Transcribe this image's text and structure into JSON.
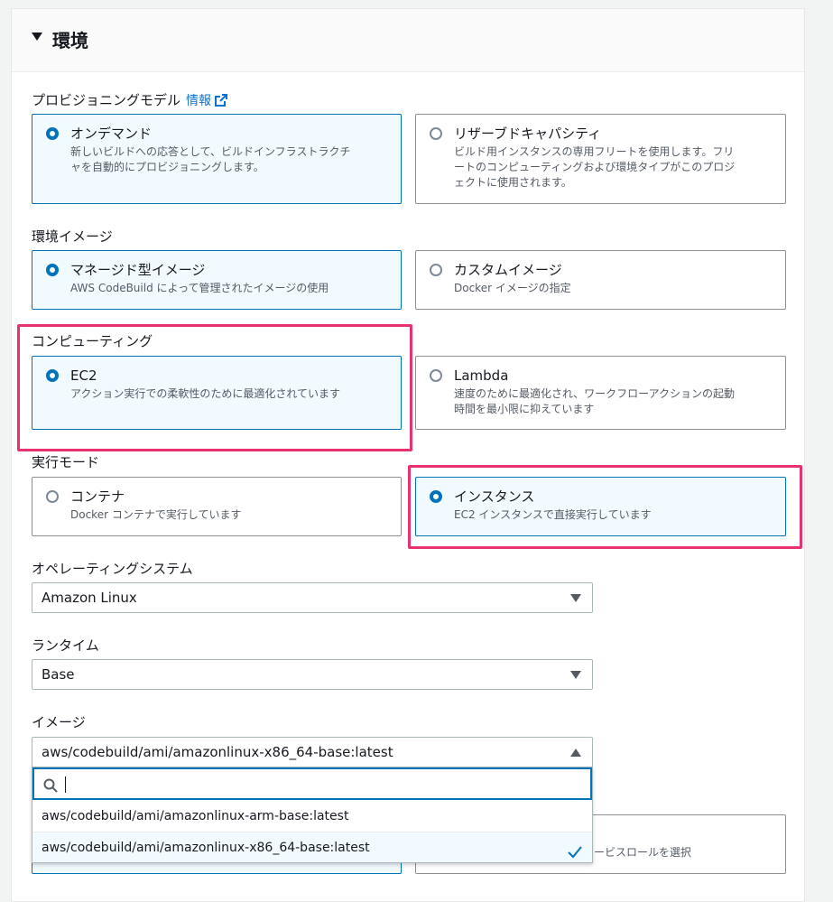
{
  "section": {
    "title": "環境"
  },
  "provisioning": {
    "label": "プロビジョニングモデル",
    "info_link": "情報",
    "options": [
      {
        "title": "オンデマンド",
        "desc1": "新しいビルドへの応答として、ビルドインフラストラクチ",
        "desc2": "ャを自動的にプロビジョニングします。",
        "desc3": ""
      },
      {
        "title": "リザーブドキャパシティ",
        "desc1": "ビルド用インスタンスの専用フリートを使用します。フリ",
        "desc2": "ートのコンピューティングおよび環境タイプがこのプロジ",
        "desc3": "ェクトに使用されます。"
      }
    ]
  },
  "environment_image": {
    "label": "環境イメージ",
    "options": [
      {
        "title": "マネージド型イメージ",
        "desc1": "AWS CodeBuild によって管理されたイメージの使用"
      },
      {
        "title": "カスタムイメージ",
        "desc1": "Docker イメージの指定"
      }
    ]
  },
  "compute": {
    "label": "コンピューティング",
    "options": [
      {
        "title": "EC2",
        "desc1": "アクション実行での柔軟性のために最適化されています",
        "desc2": ""
      },
      {
        "title": "Lambda",
        "desc1": "速度のために最適化され、ワークフローアクションの起動",
        "desc2": "時間を最小限に抑えています"
      }
    ]
  },
  "run_mode": {
    "label": "実行モード",
    "options": [
      {
        "title": "コンテナ",
        "desc1": "Docker コンテナで実行しています"
      },
      {
        "title": "インスタンス",
        "desc1": "EC2 インスタンスで直接実行しています"
      }
    ]
  },
  "os": {
    "label": "オペレーティングシステム",
    "value": "Amazon Linux"
  },
  "runtime": {
    "label": "ランタイム",
    "value": "Base"
  },
  "image": {
    "label": "イメージ",
    "value": "aws/codebuild/ami/amazonlinux-x86_64-base:latest",
    "search_value": "",
    "options": [
      "aws/codebuild/ami/amazonlinux-arm-base:latest",
      "aws/codebuild/ami/amazonlinux-x86_64-base:latest"
    ]
  },
  "service_role": {
    "partial_desc": "ービスロールを選択"
  },
  "colors": {
    "accent": "#0073bb",
    "link": "#0972d3",
    "highlight": "#e8326f",
    "selected_bg": "#f1faff"
  }
}
